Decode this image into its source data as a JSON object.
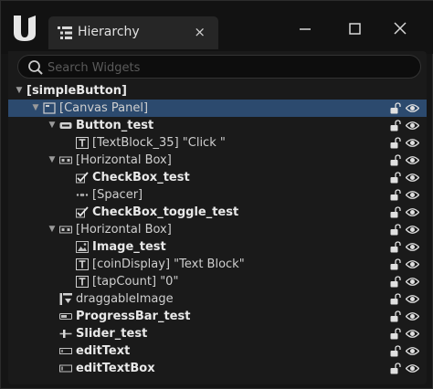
{
  "tab": {
    "title": "Hierarchy",
    "close": "×"
  },
  "search": {
    "placeholder": "Search Widgets"
  },
  "tree": [
    {
      "label": "[simpleButton]",
      "bold": true,
      "depth": 0,
      "expander": "expanded",
      "icon": "",
      "controls": false,
      "selected": false
    },
    {
      "label": "[Canvas Panel]",
      "bold": false,
      "depth": 1,
      "expander": "expanded",
      "icon": "canvas-panel-icon",
      "controls": true,
      "selected": true
    },
    {
      "label": "Button_test",
      "bold": true,
      "depth": 2,
      "expander": "expanded",
      "icon": "button-icon",
      "controls": true,
      "selected": false
    },
    {
      "label": "[TextBlock_35] \"Click \"",
      "bold": false,
      "depth": 3,
      "expander": "none",
      "icon": "text-block-icon",
      "controls": true,
      "selected": false
    },
    {
      "label": "[Horizontal Box]",
      "bold": false,
      "depth": 2,
      "expander": "expanded",
      "icon": "horizontal-box-icon",
      "controls": true,
      "selected": false
    },
    {
      "label": "CheckBox_test",
      "bold": true,
      "depth": 3,
      "expander": "none",
      "icon": "checkbox-icon",
      "controls": true,
      "selected": false
    },
    {
      "label": "[Spacer]",
      "bold": false,
      "depth": 3,
      "expander": "none",
      "icon": "spacer-icon",
      "controls": true,
      "selected": false
    },
    {
      "label": "CheckBox_toggle_test",
      "bold": true,
      "depth": 3,
      "expander": "none",
      "icon": "checkbox-icon",
      "controls": true,
      "selected": false
    },
    {
      "label": "[Horizontal Box]",
      "bold": false,
      "depth": 2,
      "expander": "expanded",
      "icon": "horizontal-box-icon",
      "controls": true,
      "selected": false
    },
    {
      "label": "Image_test",
      "bold": true,
      "depth": 3,
      "expander": "none",
      "icon": "image-icon",
      "controls": true,
      "selected": false
    },
    {
      "label": "[coinDisplay] \"Text Block\"",
      "bold": false,
      "depth": 3,
      "expander": "none",
      "icon": "text-block-icon",
      "controls": true,
      "selected": false
    },
    {
      "label": "[tapCount] \"0\"",
      "bold": false,
      "depth": 3,
      "expander": "none",
      "icon": "text-block-icon",
      "controls": true,
      "selected": false
    },
    {
      "label": "draggableImage",
      "bold": false,
      "depth": 2,
      "expander": "none",
      "icon": "user-widget-icon",
      "controls": true,
      "selected": false
    },
    {
      "label": "ProgressBar_test",
      "bold": true,
      "depth": 2,
      "expander": "none",
      "icon": "progress-bar-icon",
      "controls": true,
      "selected": false
    },
    {
      "label": "Slider_test",
      "bold": true,
      "depth": 2,
      "expander": "none",
      "icon": "slider-icon",
      "controls": true,
      "selected": false
    },
    {
      "label": "editText",
      "bold": true,
      "depth": 2,
      "expander": "none",
      "icon": "editable-text-icon",
      "controls": true,
      "selected": false
    },
    {
      "label": "editTextBox",
      "bold": true,
      "depth": 2,
      "expander": "none",
      "icon": "editable-text-box-icon",
      "controls": true,
      "selected": false
    }
  ],
  "colors": {
    "selection": "#2c4a6e",
    "background": "#1a1a1a",
    "text": "#cfcfcf"
  }
}
